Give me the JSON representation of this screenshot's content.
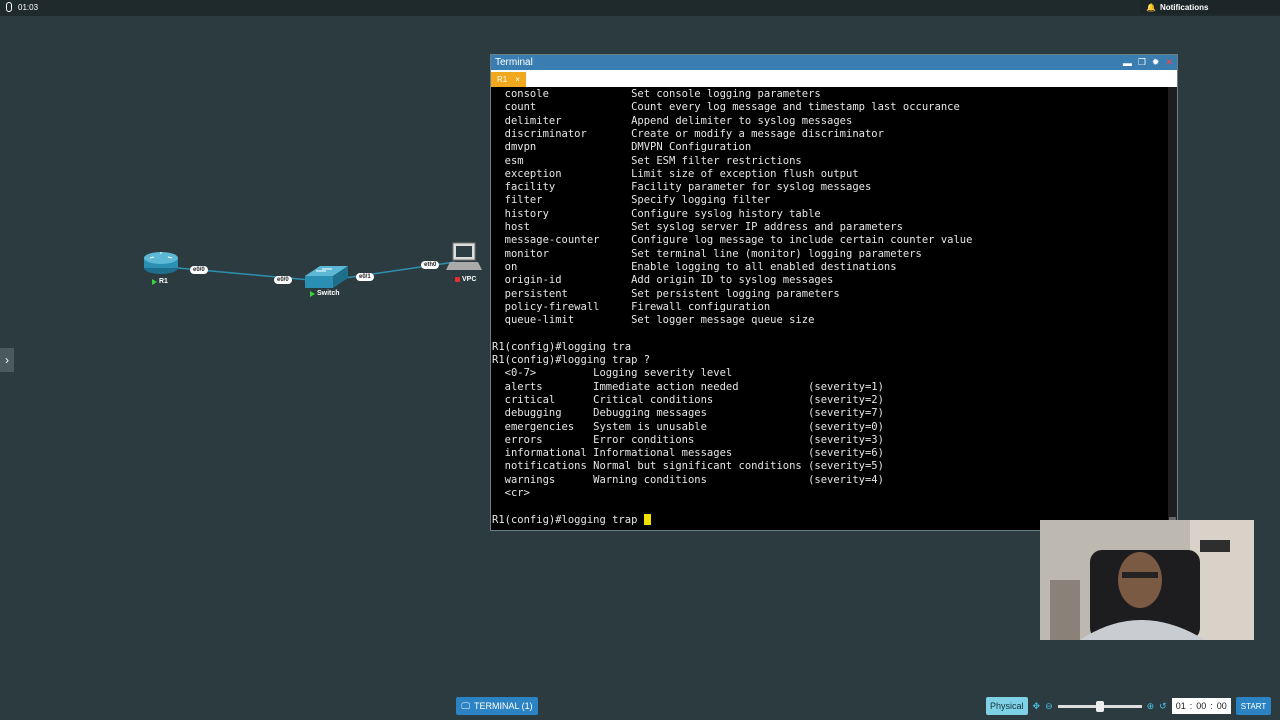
{
  "recording": {
    "time": "01:03"
  },
  "notifications": {
    "label": "Notifications"
  },
  "topology": {
    "nodes": {
      "r1": "R1",
      "switch": "Switch",
      "vpc": "VPC"
    },
    "interfaces": {
      "r1_e00": "e0/0",
      "sw_e00": "e0/0",
      "sw_e01": "e0/1",
      "vpc_eth0": "eth0"
    }
  },
  "terminal": {
    "title": "Terminal",
    "tab": "R1",
    "tab_close": "×",
    "lines": [
      "  console             Set console logging parameters",
      "  count               Count every log message and timestamp last occurance",
      "  delimiter           Append delimiter to syslog messages",
      "  discriminator       Create or modify a message discriminator",
      "  dmvpn               DMVPN Configuration",
      "  esm                 Set ESM filter restrictions",
      "  exception           Limit size of exception flush output",
      "  facility            Facility parameter for syslog messages",
      "  filter              Specify logging filter",
      "  history             Configure syslog history table",
      "  host                Set syslog server IP address and parameters",
      "  message-counter     Configure log message to include certain counter value",
      "  monitor             Set terminal line (monitor) logging parameters",
      "  on                  Enable logging to all enabled destinations",
      "  origin-id           Add origin ID to syslog messages",
      "  persistent          Set persistent logging parameters",
      "  policy-firewall     Firewall configuration",
      "  queue-limit         Set logger message queue size",
      "",
      "R1(config)#logging tra",
      "R1(config)#logging trap ?",
      "  <0-7>         Logging severity level",
      "  alerts        Immediate action needed           (severity=1)",
      "  critical      Critical conditions               (severity=2)",
      "  debugging     Debugging messages                (severity=7)",
      "  emergencies   System is unusable                (severity=0)",
      "  errors        Error conditions                  (severity=3)",
      "  informational Informational messages            (severity=6)",
      "  notifications Normal but significant conditions (severity=5)",
      "  warnings      Warning conditions                (severity=4)",
      "  <cr>",
      "",
      "R1(config)#logging trap "
    ]
  },
  "bottom": {
    "terminal_button": "TERMINAL (1)",
    "physical": "Physical",
    "timer": {
      "h": "01",
      "sep1": ":",
      "m": "00",
      "sep2": ":",
      "s": "00"
    },
    "start": "START"
  }
}
